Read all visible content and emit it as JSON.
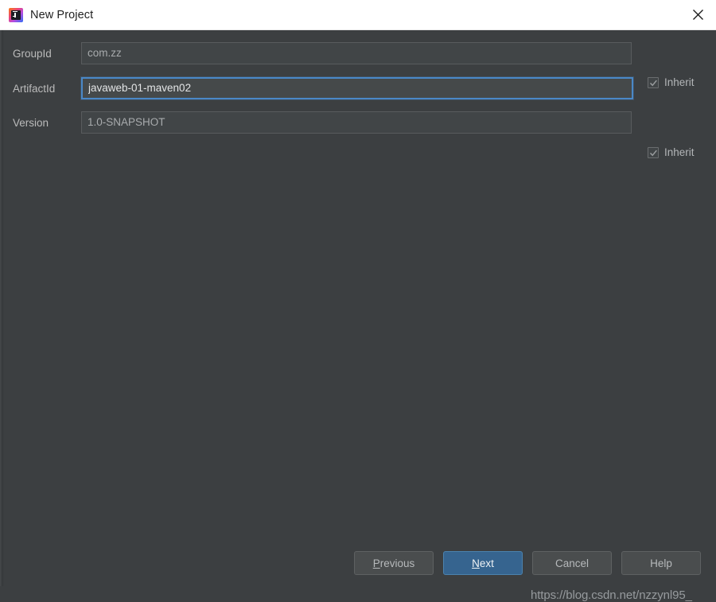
{
  "window": {
    "title": "New Project",
    "app_icon": "intellij-idea-icon",
    "close_icon": "close-icon",
    "background_color": "#3c3f41",
    "titlebar_color": "#ffffff"
  },
  "form": {
    "fields": [
      {
        "label": "GroupId",
        "value": "com.zz",
        "placeholder": "",
        "focused": false,
        "inherit": {
          "label": "Inherit",
          "checked": true
        }
      },
      {
        "label": "ArtifactId",
        "value": "javaweb-01-maven02",
        "placeholder": "",
        "focused": true,
        "inherit": null
      },
      {
        "label": "Version",
        "value": "1.0-SNAPSHOT",
        "placeholder": "",
        "focused": false,
        "inherit": {
          "label": "Inherit",
          "checked": true
        }
      }
    ]
  },
  "buttons": {
    "previous": {
      "label": "Previous",
      "mnemonic": "P",
      "primary": false
    },
    "next": {
      "label": "Next",
      "mnemonic": "N",
      "primary": true
    },
    "cancel": {
      "label": "Cancel",
      "mnemonic": "",
      "primary": false
    },
    "help": {
      "label": "Help",
      "mnemonic": "",
      "primary": false
    }
  },
  "watermark": {
    "text": "https://blog.csdn.net/nzzynl95_"
  },
  "colors": {
    "accent": "#36648f",
    "focus_border": "#4a88c7",
    "field_background": "#45494a",
    "text_primary": "#bbbbbb"
  }
}
